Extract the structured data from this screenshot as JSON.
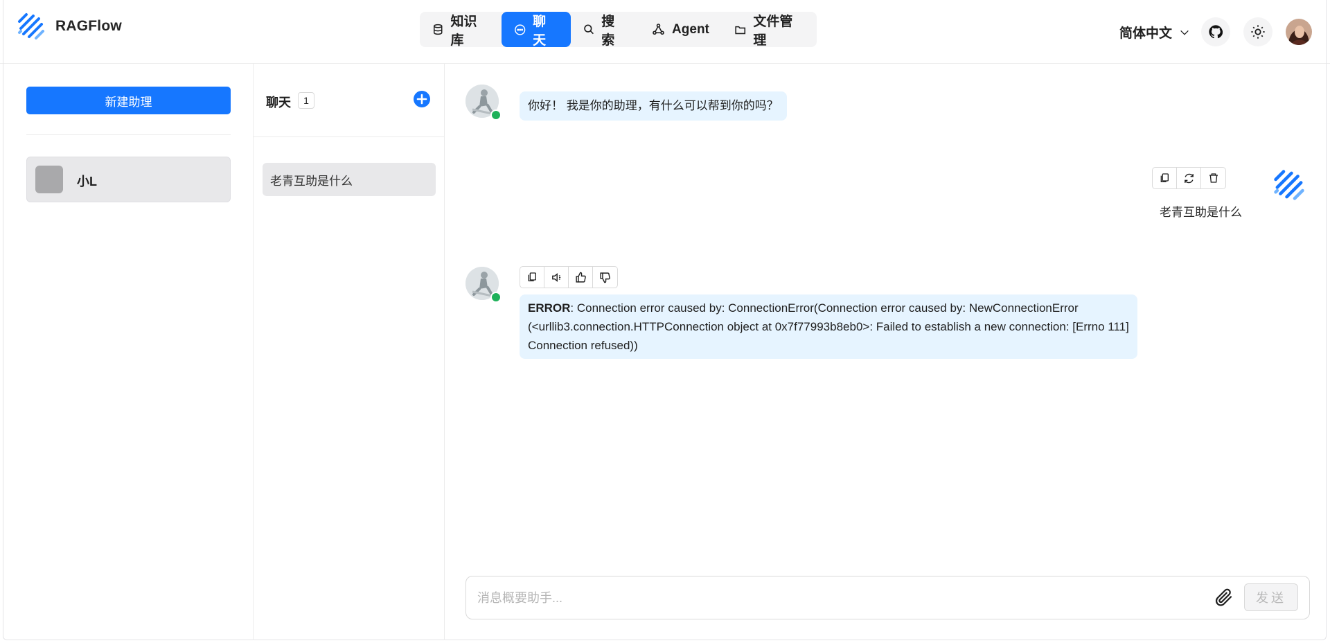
{
  "app": {
    "name": "RAGFlow"
  },
  "nav": {
    "items": [
      {
        "label": "知识库",
        "icon": "database-icon",
        "active": false
      },
      {
        "label": "聊天",
        "icon": "chat-bubble-icon",
        "active": true
      },
      {
        "label": "搜索",
        "icon": "search-icon",
        "active": false
      },
      {
        "label": "Agent",
        "icon": "agent-graph-icon",
        "active": false
      },
      {
        "label": "文件管理",
        "icon": "folder-icon",
        "active": false
      }
    ]
  },
  "header": {
    "language": "简体中文",
    "accent": "#1677ff"
  },
  "assistants": {
    "new_button": "新建助理",
    "items": [
      {
        "name": "小L"
      }
    ]
  },
  "conversations": {
    "title": "聊天",
    "count": "1",
    "items": [
      {
        "title": "老青互助是什么"
      }
    ]
  },
  "chat": {
    "greeting": "你好！ 我是你的助理，有什么可以帮到你的吗？",
    "user_message": "老青互助是什么",
    "error_label": "ERROR",
    "error_text": ": Connection error caused by: ConnectionError(Connection error caused by: NewConnectionError (<urllib3.connection.HTTPConnection object at 0x7f77993b8eb0>: Failed to establish a new connection: [Errno 111] Connection refused))",
    "input_placeholder": "消息概要助手...",
    "send_label": "发送"
  }
}
